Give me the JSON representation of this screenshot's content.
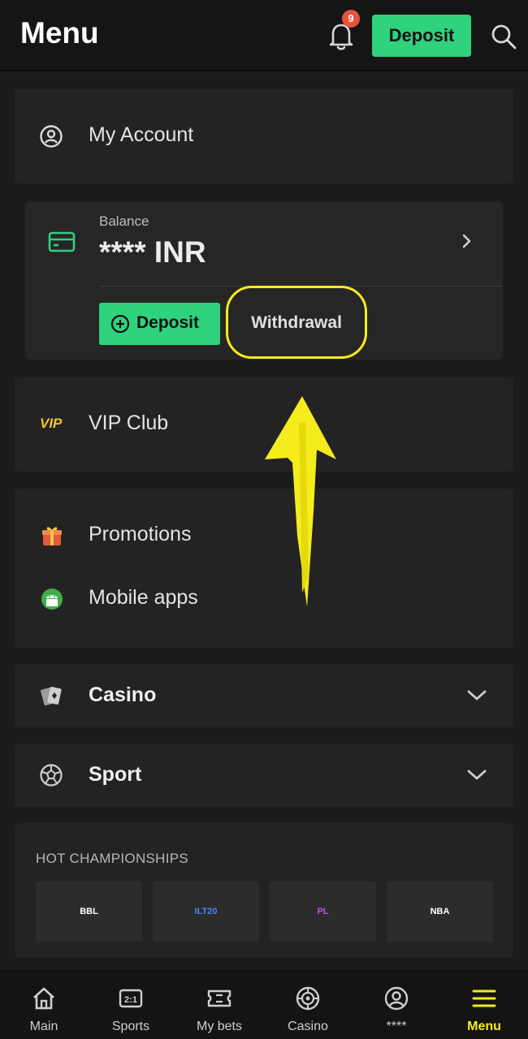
{
  "header": {
    "title": "Menu",
    "notification_count": "9",
    "deposit_label": "Deposit",
    "accent_color": "#2fd27d",
    "highlight_color": "#f5ec1d"
  },
  "account": {
    "label": "My Account",
    "icon": "user-circle-icon"
  },
  "balance": {
    "caption": "Balance",
    "value": "**** INR",
    "deposit_label": "Deposit",
    "withdrawal_label": "Withdrawal",
    "icon": "credit-card-icon"
  },
  "vip": {
    "badge": "VIP",
    "label": "VIP Club"
  },
  "links": [
    {
      "label": "Promotions",
      "icon": "gift-icon"
    },
    {
      "label": "Mobile apps",
      "icon": "android-icon"
    }
  ],
  "sections": [
    {
      "label": "Casino",
      "icon": "cards-icon"
    },
    {
      "label": "Sport",
      "icon": "football-icon"
    }
  ],
  "hot_championships": {
    "title": "HOT CHAMPIONSHIPS",
    "items": [
      {
        "logo": "BBL",
        "color": "#c0392b"
      },
      {
        "logo": "ILT20",
        "color": "#2f6fd6"
      },
      {
        "logo": "PL",
        "color": "#b02bd6"
      },
      {
        "logo": "NBA",
        "color": "#2f6fd6"
      }
    ]
  },
  "tabbar": {
    "items": [
      {
        "label": "Main",
        "icon": "home-icon"
      },
      {
        "label": "Sports",
        "icon": "scoreboard-icon"
      },
      {
        "label": "My bets",
        "icon": "ticket-icon"
      },
      {
        "label": "Casino",
        "icon": "roulette-icon"
      },
      {
        "label": "****",
        "icon": "user-circle-icon"
      },
      {
        "label": "Menu",
        "icon": "hamburger-icon",
        "active": true
      }
    ]
  }
}
